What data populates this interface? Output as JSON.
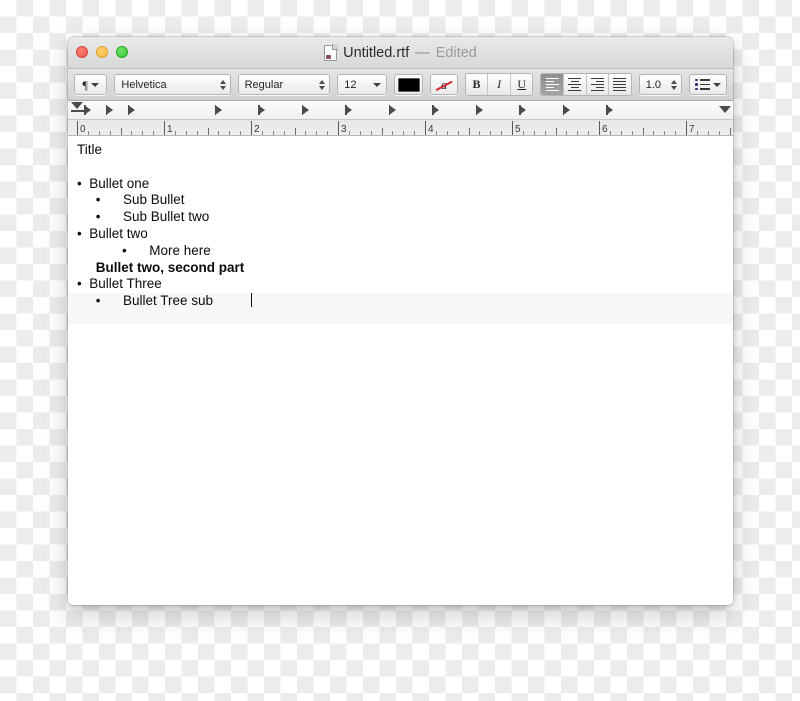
{
  "window": {
    "title_filename": "Untitled.rtf",
    "title_separator": "—",
    "title_status": "Edited",
    "doc_icon": "rtf-document-icon",
    "traffic_lights": [
      {
        "name": "close-button",
        "label": "Close",
        "color": "#ed5a4f"
      },
      {
        "name": "minimize-button",
        "label": "Minimize",
        "color": "#f6b83c"
      },
      {
        "name": "zoom-button",
        "label": "Zoom",
        "color": "#2ec92e"
      }
    ]
  },
  "toolbar": {
    "paragraph_style_label": "¶",
    "font_family": "Helvetica",
    "font_style": "Regular",
    "font_size": "12",
    "text_color": "#000000",
    "remove_color_label": "a",
    "bold_label": "B",
    "italic_label": "I",
    "underline_label": "U",
    "alignment": [
      {
        "name": "align-left-button",
        "label": "Align Left",
        "selected": true
      },
      {
        "name": "align-center-button",
        "label": "Align Center",
        "selected": false
      },
      {
        "name": "align-right-button",
        "label": "Align Right",
        "selected": false
      },
      {
        "name": "align-justify-button",
        "label": "Justify",
        "selected": false
      }
    ],
    "line_spacing": "1.0",
    "list_label": "Lists"
  },
  "ruler": {
    "numbers": [
      "0",
      "1",
      "2",
      "3",
      "4",
      "5",
      "6",
      "7"
    ],
    "unit": "inches",
    "tab_stops": [
      "0",
      "0.25",
      "0.5",
      "1.5",
      "2",
      "2.5",
      "3",
      "3.5",
      "4",
      "4.5",
      "5",
      "5.5",
      "6"
    ],
    "left_indent_marker": "0",
    "right_indent_marker": "7.5"
  },
  "document": {
    "lines": [
      {
        "text": "Title",
        "bold": false
      },
      {
        "text": "",
        "bold": false
      },
      {
        "text": "•  Bullet one",
        "bold": false
      },
      {
        "text": "     •      Sub Bullet",
        "bold": false
      },
      {
        "text": "     •      Sub Bullet two",
        "bold": false
      },
      {
        "text": "•  Bullet two",
        "bold": false
      },
      {
        "text": "            •      More here",
        "bold": false
      },
      {
        "text": "     Bullet two, second part",
        "bold": true
      },
      {
        "text": "•  Bullet Three",
        "bold": false
      },
      {
        "text": "     •      Bullet Tree sub",
        "bold": false
      }
    ],
    "caret_on_line_index": 9,
    "highlight_color": "#f7f7f9"
  }
}
